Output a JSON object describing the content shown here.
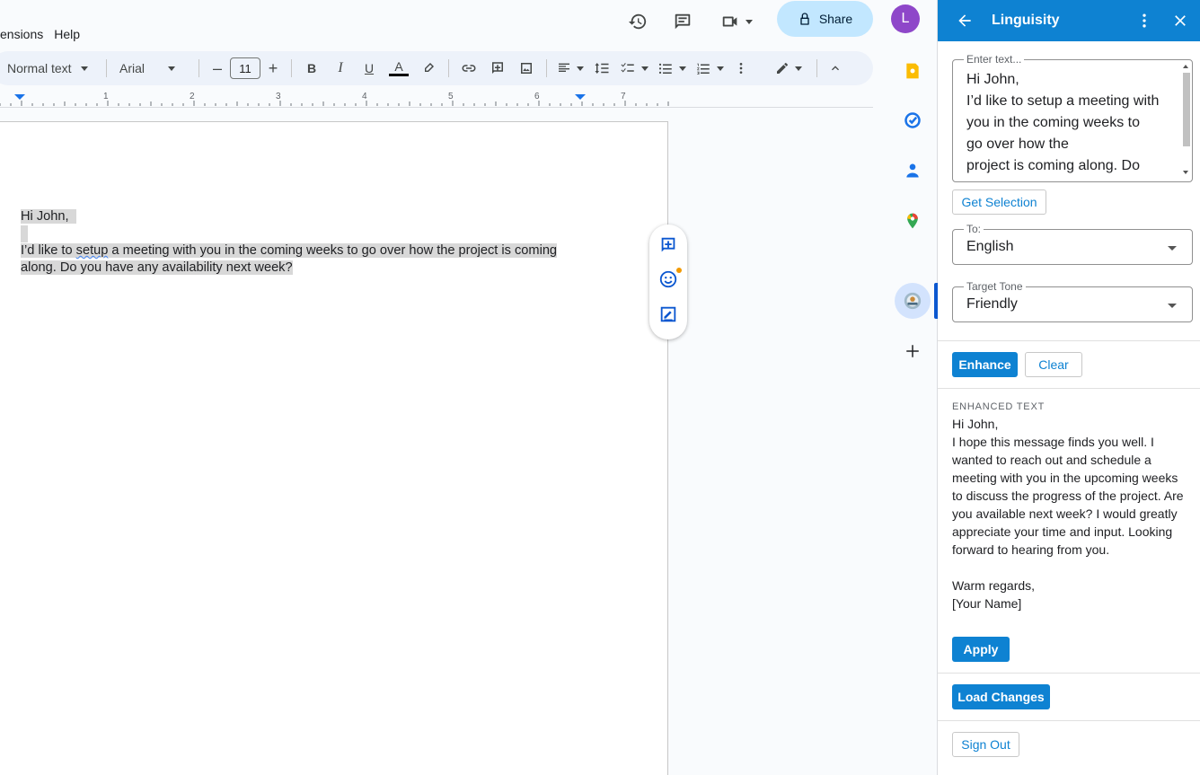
{
  "menubar": {
    "items": [
      "ensions",
      "Help"
    ]
  },
  "header": {
    "share_label": "Share",
    "avatar_initial": "L"
  },
  "toolbar": {
    "style": "Normal text",
    "font": "Arial",
    "font_size": "11"
  },
  "ruler": {
    "numbers": [
      "1",
      "2",
      "3",
      "4",
      "5",
      "6",
      "7"
    ]
  },
  "document": {
    "line1": "Hi John,",
    "line2a": "I’d like to ",
    "line2b": "setup",
    "line2c": " a meeting with you in the coming weeks to go over how the project is coming",
    "line3": "along. Do you have any availability next week?"
  },
  "panel": {
    "title": "Linguisity",
    "input_legend": "Enter text...",
    "input_text": "Hi John,\nI’d like to setup a meeting with you in the coming weeks to go over how the project is coming along. Do you have any availability next week?",
    "get_selection_label": "Get Selection",
    "to_legend": "To:",
    "to_value": "English",
    "tone_legend": "Target Tone",
    "tone_value": "Friendly",
    "enhance_label": "Enhance",
    "clear_label": "Clear",
    "enhanced_label": "ENHANCED TEXT",
    "enhanced_text": "Hi John,\nI hope this message finds you well. I wanted to reach out and schedule a meeting with you in the upcoming weeks to discuss the progress of the project. Are you available next week? I would greatly appreciate your time and input. Looking forward to hearing from you.\n\nWarm regards,\n[Your Name]",
    "apply_label": "Apply",
    "load_changes_label": "Load Changes",
    "sign_out_label": "Sign Out"
  },
  "colors": {
    "accent": "#0e82d2",
    "share_bg": "#c2e7ff",
    "avatar": "#8e47c9"
  }
}
